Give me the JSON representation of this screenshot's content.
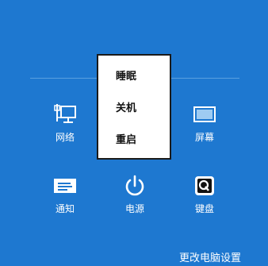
{
  "settings_pane": {
    "tiles": {
      "network": {
        "label": "网络",
        "icon": "network-icon"
      },
      "screen": {
        "label": "屏幕",
        "icon": "screen-brightness-icon"
      },
      "notifications": {
        "label": "通知",
        "icon": "notifications-icon"
      },
      "power": {
        "label": "电源",
        "icon": "power-icon"
      },
      "keyboard": {
        "label": "键盘",
        "icon": "keyboard-icon"
      }
    },
    "power_menu": {
      "items": [
        {
          "label": "睡眠"
        },
        {
          "label": "关机"
        },
        {
          "label": "重启"
        }
      ]
    },
    "footer": {
      "change_settings_label": "更改电脑设置"
    }
  },
  "colors": {
    "background": "#1e78d0",
    "separator": "#5aa0e0",
    "menu_background": "#ffffff",
    "menu_border": "#1a1a1a",
    "menu_text": "#111111",
    "text": "#ffffff"
  }
}
